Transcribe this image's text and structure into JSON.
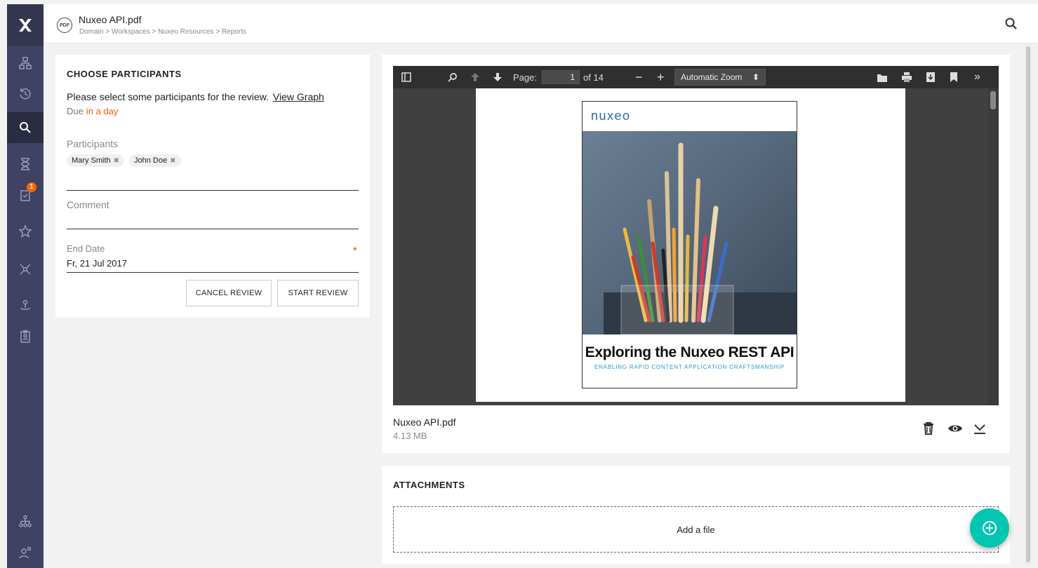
{
  "topbar": {
    "file_badge": "PDF",
    "title": "Nuxeo API.pdf",
    "breadcrumb": "Domain > Workspaces > Nuxeo Resources > Reports",
    "search_icon": "search-icon"
  },
  "sidebar": {
    "logo_icon": "nuxeo-x-logo",
    "items": [
      {
        "icon": "browse-tree-icon"
      },
      {
        "icon": "history-icon"
      },
      {
        "icon": "search-icon",
        "active": true
      },
      {
        "icon": "hourglass-icon"
      },
      {
        "icon": "tasks-icon",
        "badge": "1"
      },
      {
        "icon": "star-icon"
      },
      {
        "icon": "collections-icon"
      },
      {
        "icon": "personal-workspace-icon"
      },
      {
        "icon": "clipboard-icon"
      }
    ],
    "bottom_items": [
      {
        "icon": "administration-icon"
      },
      {
        "icon": "user-settings-icon"
      }
    ]
  },
  "review": {
    "section_title": "CHOOSE PARTICIPANTS",
    "instructions": "Please select some participants for the review.",
    "view_graph": "View Graph",
    "due_label": "Due",
    "due_value": "in a day",
    "participants_label": "Participants",
    "participants": [
      "Mary Smith",
      "John Doe"
    ],
    "comment_label": "Comment",
    "end_date_label": "End Date",
    "end_date_value": "Fr, 21 Jul 2017",
    "required_mark": "*",
    "cancel_label": "CANCEL REVIEW",
    "start_label": "START REVIEW"
  },
  "viewer": {
    "page_label": "Page:",
    "page_value": "1",
    "page_total": "of 14",
    "zoom_value": "Automatic Zoom",
    "cover_logo": "nuxeo",
    "cover_title": "Exploring the Nuxeo REST API",
    "cover_subtitle": "ENABLING RAPID CONTENT APPLICATION CRAFTSMANSHIP"
  },
  "file": {
    "name": "Nuxeo API.pdf",
    "size": "4.13 MB"
  },
  "attachments": {
    "title": "ATTACHMENTS",
    "dropzone": "Add a file"
  },
  "colors": {
    "sidebar": "#3f4263",
    "accent_orange": "#ff5900",
    "fab": "#00c6b2",
    "brand_blue": "#2a6aa0"
  }
}
